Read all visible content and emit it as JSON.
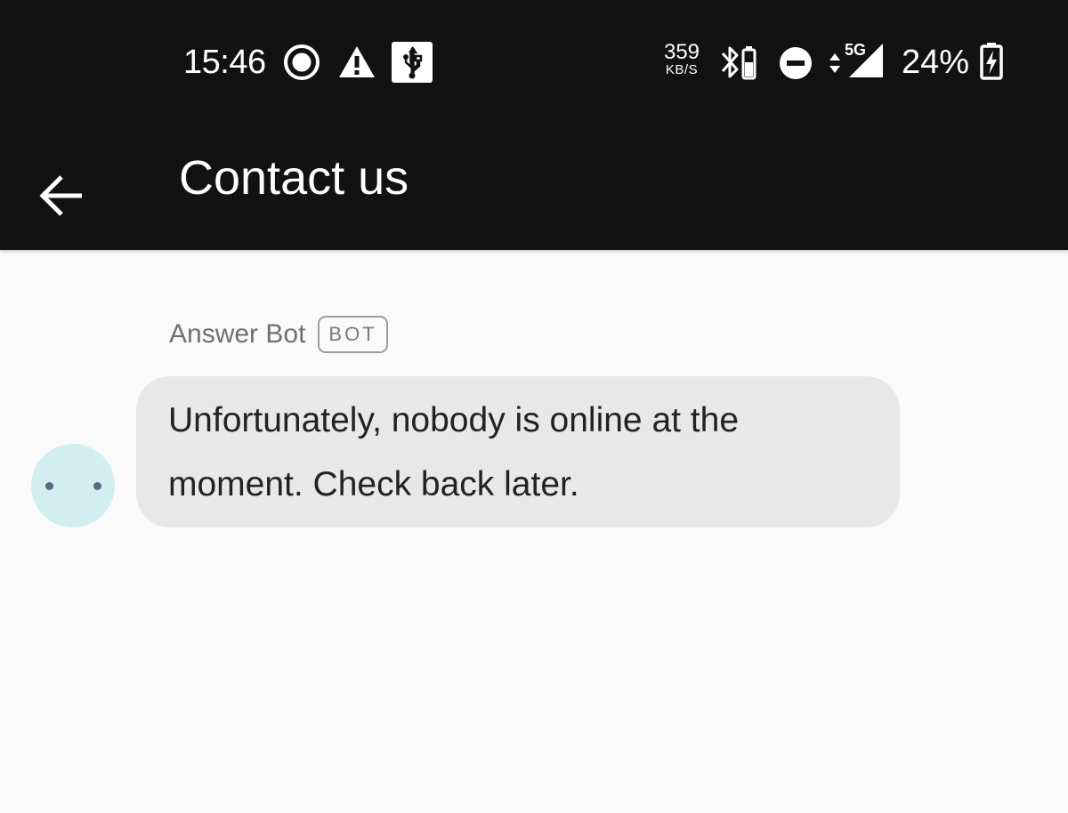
{
  "status_bar": {
    "time": "15:46",
    "left_icons": [
      "record-icon",
      "warning-icon",
      "usb-icon"
    ],
    "network_speed_value": "359",
    "network_speed_unit": "KB/S",
    "right_icons": [
      "bluetooth-battery-icon",
      "do-not-disturb-icon",
      "data-arrows-icon",
      "signal-5g-icon",
      "battery-charging-icon"
    ],
    "network_type": "5G",
    "battery_percent": "24%"
  },
  "app_bar": {
    "back_icon": "arrow-back-icon",
    "title": "Contact us"
  },
  "chat": {
    "messages": [
      {
        "sender": "Answer Bot",
        "badge": "BOT",
        "avatar": "bot-face-icon",
        "text": "Unfortunately, nobody is online at the moment. Check back later."
      }
    ]
  },
  "colors": {
    "bar_background": "#121212",
    "page_background": "#fafafa",
    "bubble_background": "#e8e8e8",
    "avatar_background": "#d3eef0",
    "avatar_eyes": "#5e6580"
  }
}
